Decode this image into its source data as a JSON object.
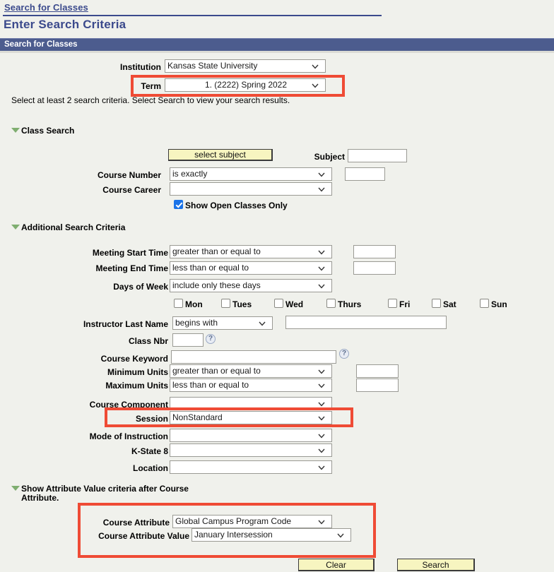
{
  "breadcrumb": "Search for Classes",
  "page_title": "Enter Search Criteria",
  "section_bar_title": "Search for Classes",
  "accent_color": "#4c5c8e",
  "highlight_color": "#ef4b35",
  "top": {
    "institution_label": "Institution",
    "institution_value": "Kansas State University",
    "term_label": "Term",
    "term_value": "1. (2222) Spring 2022",
    "instructions": "Select at least 2 search criteria. Select Search to view your search results."
  },
  "class_search": {
    "header": "Class Search",
    "select_subject_button": "select subject",
    "subject_label": "Subject",
    "subject_value": "",
    "course_number_label": "Course Number",
    "course_number_operator": "is exactly",
    "course_number_value": "",
    "course_career_label": "Course Career",
    "course_career_value": "",
    "show_open_label": "Show Open Classes Only",
    "show_open_checked": true
  },
  "additional": {
    "header": "Additional Search Criteria",
    "meeting_start_label": "Meeting Start Time",
    "meeting_start_operator": "greater than or equal to",
    "meeting_start_value": "",
    "meeting_end_label": "Meeting End Time",
    "meeting_end_operator": "less than or equal to",
    "meeting_end_value": "",
    "days_of_week_label": "Days of Week",
    "days_of_week_operator": "include only these days",
    "days": [
      {
        "label": "Mon",
        "checked": false
      },
      {
        "label": "Tues",
        "checked": false
      },
      {
        "label": "Wed",
        "checked": false
      },
      {
        "label": "Thurs",
        "checked": false
      },
      {
        "label": "Fri",
        "checked": false
      },
      {
        "label": "Sat",
        "checked": false
      },
      {
        "label": "Sun",
        "checked": false
      }
    ],
    "instructor_label": "Instructor Last Name",
    "instructor_operator": "begins with",
    "instructor_value": "",
    "class_nbr_label": "Class Nbr",
    "class_nbr_value": "",
    "class_nbr_help": "?",
    "course_keyword_label": "Course Keyword",
    "course_keyword_value": "",
    "course_keyword_help": "?",
    "minimum_units_label": "Minimum Units",
    "minimum_units_operator": "greater than or equal to",
    "minimum_units_value": "",
    "maximum_units_label": "Maximum Units",
    "maximum_units_operator": "less than or equal to",
    "maximum_units_value": "",
    "course_component_label": "Course Component",
    "course_component_value": "",
    "session_label": "Session",
    "session_value": "NonStandard",
    "mode_label": "Mode of Instruction",
    "mode_value": "",
    "kstate8_label": "K-State 8",
    "kstate8_value": "",
    "location_label": "Location",
    "location_value": ""
  },
  "attribute": {
    "header_line1": "Show Attribute Value criteria after Course",
    "header_line2": "Attribute.",
    "course_attribute_label": "Course Attribute",
    "course_attribute_value": "Global Campus Program Code",
    "course_attribute_value_label": "Course Attribute Value",
    "course_attribute_value_value": "January Intersession"
  },
  "buttons": {
    "clear": "Clear",
    "search": "Search"
  }
}
